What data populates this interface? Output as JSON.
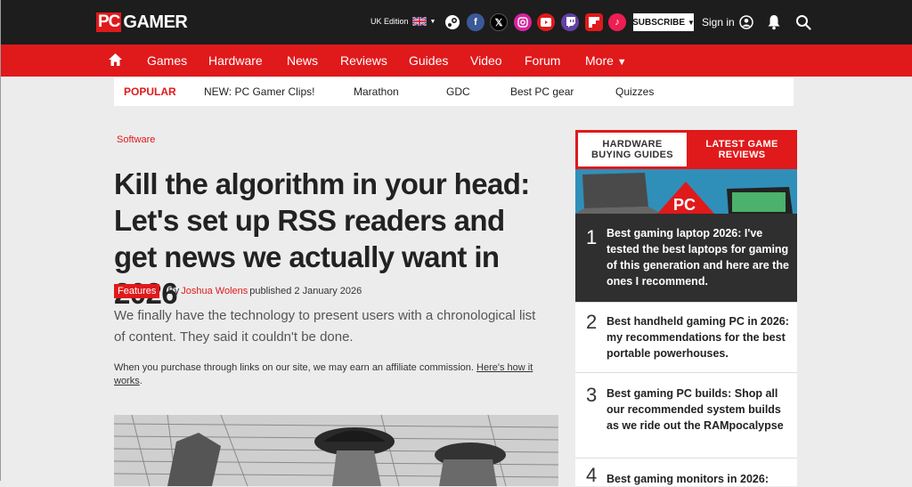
{
  "header": {
    "logo_pc": "PC",
    "logo_gamer": "GAMER",
    "edition": "UK Edition",
    "subscribe": "SUBSCRIBE",
    "signin": "Sign in",
    "social_icons": [
      "steam-icon",
      "facebook-icon",
      "x-icon",
      "instagram-icon",
      "youtube-icon",
      "twitch-icon",
      "flipboard-icon",
      "tiktok-icon"
    ]
  },
  "nav": {
    "items": [
      "Games",
      "Hardware",
      "News",
      "Reviews",
      "Guides",
      "Video",
      "Forum",
      "More"
    ]
  },
  "popular": {
    "label": "POPULAR",
    "items": [
      "NEW: PC Gamer Clips!",
      "Marathon",
      "GDC",
      "Best PC gear",
      "Quizzes"
    ]
  },
  "article": {
    "category": "Software",
    "title": "Kill the algorithm in your head: Let's set up RSS readers and get news we actually want in 2026",
    "badge": "Features",
    "by": "By",
    "author": "Joshua Wolens",
    "published": "published 2 January 2026",
    "standfirst": "We finally have the technology to present users with a chronological list of content. They said it couldn't be done.",
    "affiliate_text": "When you purchase through links on our site, we may earn an affiliate commission.",
    "affiliate_link": "Here's how it works",
    "affiliate_end": "."
  },
  "sidebar": {
    "tab1_line1": "HARDWARE",
    "tab1_line2": "BUYING GUIDES",
    "tab2_line1": "LATEST GAME",
    "tab2_line2": "REVIEWS",
    "promo_badge": "PC",
    "items": [
      {
        "num": "1",
        "text": "Best gaming laptop 2026: I've tested the best laptops for gaming of this generation and here are the ones I recommend."
      },
      {
        "num": "2",
        "text": "Best handheld gaming PC in 2026: my recommendations for the best portable powerhouses."
      },
      {
        "num": "3",
        "text": "Best gaming PC builds: Shop all our recommended system builds as we ride out the RAMpocalypse"
      },
      {
        "num": "4",
        "text": "Best gaming monitors in 2026:"
      }
    ]
  },
  "colors": {
    "brand_red": "#e0191b",
    "topbar": "#1d1d1d"
  }
}
